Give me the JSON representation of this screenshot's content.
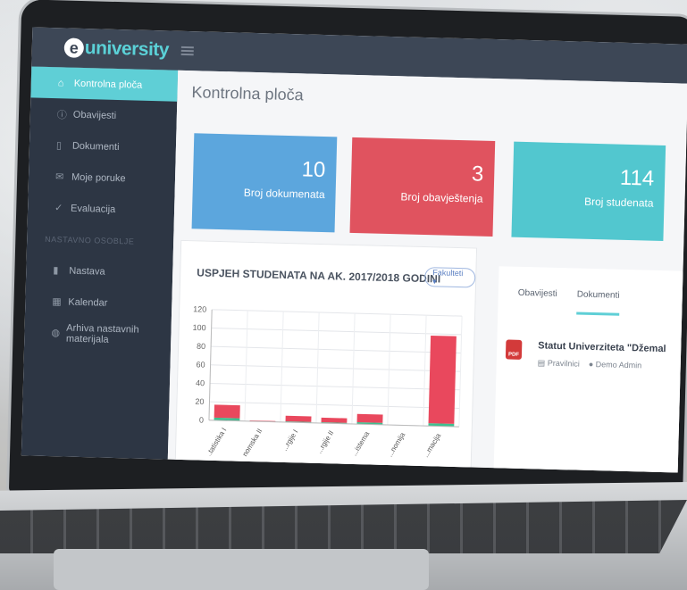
{
  "app": {
    "logo_letter": "e",
    "logo_text": "university"
  },
  "sidebar": {
    "items": [
      {
        "label": "Kontrolna ploča",
        "icon": "home-icon"
      },
      {
        "label": "Obavijesti",
        "icon": "info-icon"
      },
      {
        "label": "Dokumenti",
        "icon": "document-icon"
      },
      {
        "label": "Moje poruke",
        "icon": "envelope-icon"
      },
      {
        "label": "Evaluacija",
        "icon": "check-circle-icon"
      }
    ],
    "section_label": "NASTAVNO OSOBLJE",
    "section_items": [
      {
        "label": "Nastava",
        "icon": "book-icon"
      },
      {
        "label": "Kalendar",
        "icon": "calendar-icon"
      },
      {
        "label": "Arhiva nastavnih materijala",
        "icon": "archive-icon"
      }
    ]
  },
  "main": {
    "page_title": "Kontrolna ploča",
    "cards": [
      {
        "value": "10",
        "label": "Broj dokumenata",
        "color": "#5ca6dd"
      },
      {
        "value": "3",
        "label": "Broj obavještenja",
        "color": "#e0535f"
      },
      {
        "value": "114",
        "label": "Broj studenata",
        "color": "#52c7cf"
      }
    ]
  },
  "chart_panel": {
    "title": "USPJEH STUDENATA NA AK. 2017/2018 GODINI",
    "filter_button": "Fakulteti ▾"
  },
  "chart_data": {
    "type": "bar",
    "categories": [
      "...tatistika I",
      "...nomska II",
      "...rgije I",
      "...rgije II",
      "...istema",
      "...nomija",
      "...macija"
    ],
    "series": [
      {
        "values": [
          14,
          1,
          6,
          5,
          9,
          0,
          95
        ],
        "color": "#e9485d"
      },
      {
        "values": [
          3,
          0,
          1,
          1,
          2,
          0,
          3
        ],
        "color": "#3fbf8f"
      }
    ],
    "ylim": [
      0,
      120
    ],
    "yticks": [
      0,
      20,
      40,
      60,
      80,
      100,
      120
    ],
    "grid": true
  },
  "tabs_panel": {
    "tabs": [
      "Obavijesti",
      "Dokumenti"
    ],
    "active_tab": "Dokumenti",
    "document": {
      "badge": "PDF",
      "title": "Statut Univerziteta \"Džemal",
      "category": "Pravilnici",
      "author": "Demo Admin"
    }
  }
}
